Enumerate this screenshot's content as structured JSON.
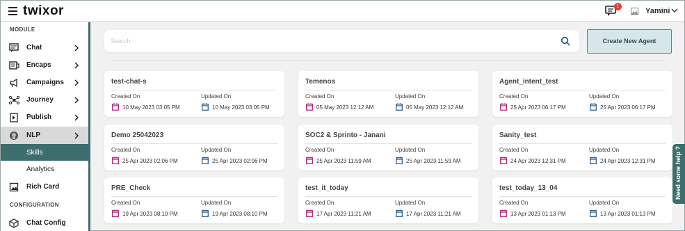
{
  "header": {
    "brand": "twixor",
    "notification_count": "1",
    "user_name": "Yamini"
  },
  "sidebar": {
    "sections": [
      "MODULE",
      "CONFIGURATION"
    ],
    "items": [
      {
        "label": "Chat",
        "icon": "chat-icon"
      },
      {
        "label": "Encaps",
        "icon": "encaps-icon"
      },
      {
        "label": "Campaigns",
        "icon": "megaphone-icon"
      },
      {
        "label": "Journey",
        "icon": "journey-icon"
      },
      {
        "label": "Publish",
        "icon": "publish-icon"
      },
      {
        "label": "NLP",
        "icon": "nlp-icon"
      },
      {
        "label": "Skills"
      },
      {
        "label": "Analytics"
      },
      {
        "label": "Rich Card",
        "icon": "rich-card-icon"
      },
      {
        "label": "Chat Config",
        "icon": "cube-icon"
      }
    ]
  },
  "search": {
    "placeholder": "Search"
  },
  "toolbar": {
    "create_label": "Create New Agent"
  },
  "labels": {
    "created": "Created On",
    "updated": "Updated On"
  },
  "agents": [
    {
      "name": "test-chat-s",
      "created": "10 May 2023 03:05 PM",
      "updated": "10 May 2023 03:05 PM"
    },
    {
      "name": "Temenos",
      "created": "05 May 2023 12:12 AM",
      "updated": "05 May 2023 12:12 AM"
    },
    {
      "name": "Agent_intent_test",
      "created": "25 Apr 2023 06:17 PM",
      "updated": "25 Apr 2023 06:17 PM"
    },
    {
      "name": "Demo 25042023",
      "created": "25 Apr 2023 02:06 PM",
      "updated": "25 Apr 2023 02:06 PM"
    },
    {
      "name": "SOC2 & Sprinto - Janani",
      "created": "25 Apr 2023 11:59 AM",
      "updated": "25 Apr 2023 11:59 AM"
    },
    {
      "name": "Sanity_test",
      "created": "24 Apr 2023 12:31 PM",
      "updated": "24 Apr 2023 12:31 PM"
    },
    {
      "name": "PRE_Check",
      "created": "19 Apr 2023 08:10 PM",
      "updated": "19 Apr 2023 08:10 PM"
    },
    {
      "name": "test_it_today",
      "created": "17 Apr 2023 11:21 AM",
      "updated": "17 Apr 2023 11:21 AM"
    },
    {
      "name": "test_today_13_04",
      "created": "13 Apr 2023 01:13 PM",
      "updated": "13 Apr 2023 01:13 PM"
    }
  ],
  "help": {
    "label": "Need some help ?"
  },
  "colors": {
    "accent": "#3d6e6e",
    "created_icon": "#b0287a",
    "updated_icon": "#2f5f8f",
    "badge": "#e23b3b"
  }
}
